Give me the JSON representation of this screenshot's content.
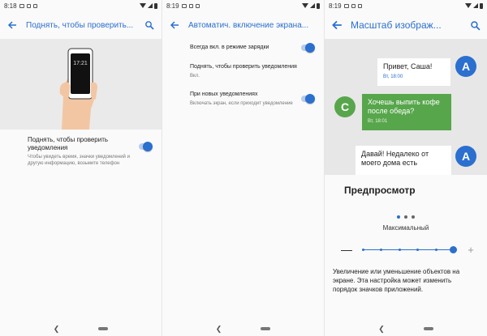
{
  "screens": [
    {
      "status_time": "8:18",
      "title": "Поднять, чтобы проверить...",
      "setting": {
        "title": "Поднять, чтобы проверить уведомления",
        "subtitle": "Чтобы увидеть время, значки уведомлений и другую информацию, возьмите телефон",
        "enabled": true
      },
      "phone_time": "17:21"
    },
    {
      "status_time": "8:19",
      "title": "Автоматич. включение экрана...",
      "items": [
        {
          "title": "Всегда вкл. в режиме зарядки",
          "subtitle": "",
          "toggle": true
        },
        {
          "title": "Поднять, чтобы проверить уведомления",
          "subtitle": "Вкл.",
          "toggle": false
        },
        {
          "title": "При новых уведомлениях",
          "subtitle": "Включать экран, если приходит уведомление",
          "toggle": true
        }
      ]
    },
    {
      "status_time": "8:19",
      "title": "Масштаб изображ...",
      "messages": [
        {
          "text": "Привет, Саша!",
          "time": "Вт, 18:00",
          "avatar": "A"
        },
        {
          "text": "Хочешь выпить кофе после обеда?",
          "time": "Вт, 18:01",
          "avatar": "C"
        },
        {
          "text": "Давай! Недалеко от моего дома есть",
          "time": "",
          "avatar": "A"
        }
      ],
      "preview_label": "Предпросмотр",
      "scale_label": "Максимальный",
      "slider_level_fraction": 1.0,
      "description": "Увеличение или уменьшение объектов на экране. Эта настройка может изменить порядок значков приложений."
    }
  ],
  "colors": {
    "accent": "#2b6fcf",
    "green_bubble": "#57a64b",
    "avatar_a": "#2b6fcf",
    "avatar_c": "#57a64b"
  }
}
